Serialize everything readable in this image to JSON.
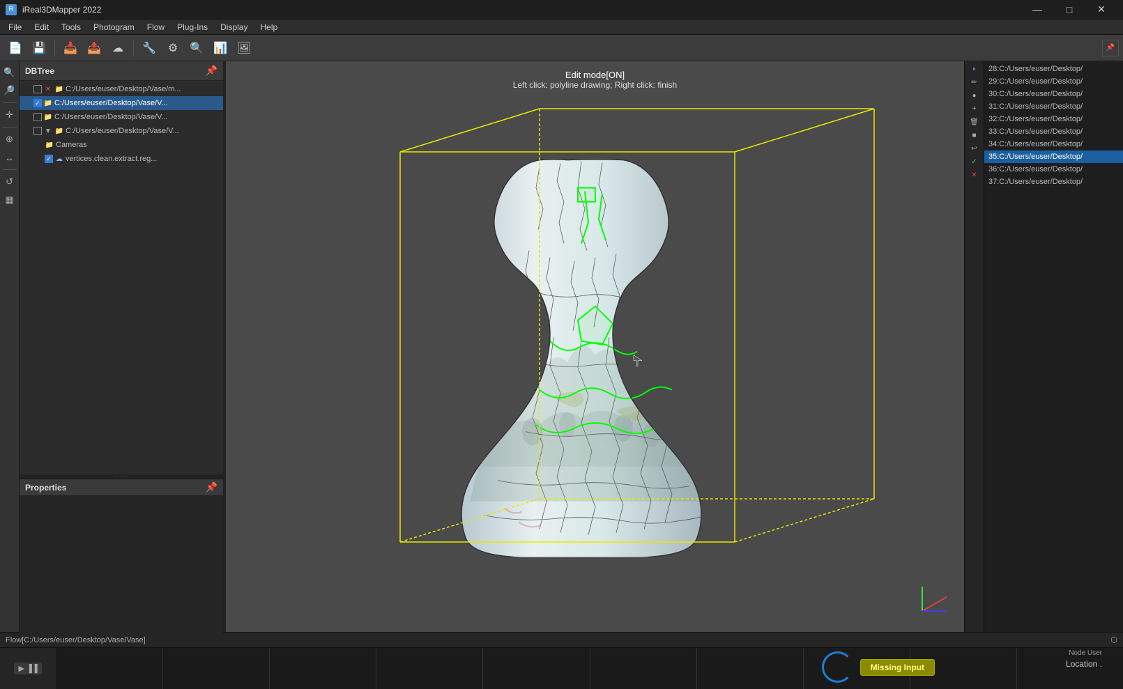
{
  "titlebar": {
    "title": "iReal3DMapper 2022",
    "icon": "R",
    "minimize": "—",
    "maximize": "□",
    "close": "✕"
  },
  "menubar": {
    "items": [
      "File",
      "Edit",
      "Tools",
      "Photogram",
      "Flow",
      "Plug-Ins",
      "Display",
      "Help"
    ]
  },
  "dbtree": {
    "title": "DBTree",
    "items": [
      {
        "level": 1,
        "checked": false,
        "crossed": true,
        "label": "C:/Users/euser/Desktop/Vase/m...",
        "icon": "folder"
      },
      {
        "level": 1,
        "checked": true,
        "crossed": false,
        "label": "C:/Users/euser/Desktop/Vase/V...",
        "icon": "folder",
        "highlight": true
      },
      {
        "level": 1,
        "checked": false,
        "crossed": false,
        "label": "C:/Users/euser/Desktop/Vase/V...",
        "icon": "folder"
      },
      {
        "level": 1,
        "checked": false,
        "crossed": false,
        "label": "C:/Users/euser/Desktop/Vase/V...",
        "icon": "folder"
      },
      {
        "level": 2,
        "checked": false,
        "crossed": false,
        "label": "Cameras",
        "icon": "folder"
      },
      {
        "level": 2,
        "checked": true,
        "crossed": false,
        "label": "vertices.clean.extract.reg...",
        "icon": "cloud"
      }
    ]
  },
  "properties": {
    "title": "Properties"
  },
  "viewport": {
    "edit_mode_line1": "Edit mode[ON]",
    "edit_mode_line2": "Left click: polyline drawing; Right click: finish"
  },
  "right_panel": {
    "items": [
      "28:C:/Users/euser/Desktop/",
      "29:C:/Users/euser/Desktop/",
      "30:C:/Users/euser/Desktop/",
      "31:C:/Users/euser/Desktop/",
      "32:C:/Users/euser/Desktop/",
      "33:C:/Users/euser/Desktop/",
      "34:C:/Users/euser/Desktop/",
      "35:C:/Users/euser/Desktop/",
      "36:C:/Users/euser/Desktop/",
      "37:C:/Users/euser/Desktop/"
    ],
    "selected_index": 7
  },
  "bottom": {
    "flow_path": "Flow[C:/Users/euser/Desktop/Vase/Vase]",
    "expand_icon": "⬡"
  },
  "flow": {
    "missing_input_label": "Missing Input",
    "location_label": "Location ."
  },
  "right_mini_toolbar": {
    "buttons": [
      "⏸",
      "✏",
      "⬤",
      "✚",
      "🗑",
      "⬛",
      "↩",
      "✓",
      "✕"
    ]
  }
}
